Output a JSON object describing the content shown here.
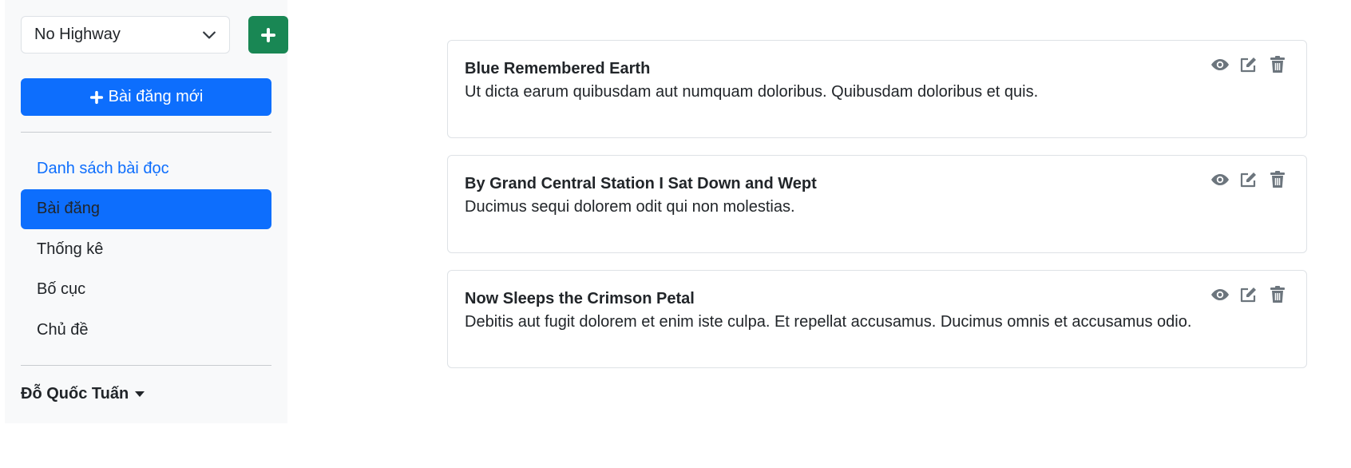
{
  "sidebar": {
    "blog_select": {
      "value": "No Highway"
    },
    "new_post_label": "Bài đăng mới",
    "nav": [
      {
        "label": "Danh sách bài đọc",
        "state": "link"
      },
      {
        "label": "Bài đăng",
        "state": "active"
      },
      {
        "label": "Thống kê",
        "state": "normal"
      },
      {
        "label": "Bố cục",
        "state": "normal"
      },
      {
        "label": "Chủ đề",
        "state": "normal"
      }
    ],
    "user": {
      "name": "Đỗ Quốc Tuấn"
    }
  },
  "posts": [
    {
      "title": "Blue Remembered Earth",
      "excerpt": "Ut dicta earum quibusdam aut numquam doloribus. Quibusdam doloribus et quis."
    },
    {
      "title": "By Grand Central Station I Sat Down and Wept",
      "excerpt": "Ducimus sequi dolorem odit qui non molestias."
    },
    {
      "title": "Now Sleeps the Crimson Petal",
      "excerpt": "Debitis aut fugit dolorem et enim iste culpa. Et repellat accusamus. Ducimus omnis et accusamus odio."
    }
  ],
  "icons": {
    "view": "eye-icon",
    "edit": "edit-icon",
    "delete": "trash-icon",
    "add": "plus-icon",
    "dropdown": "chevron-down-icon"
  },
  "colors": {
    "primary": "#0d6efd",
    "success": "#198754",
    "sidebar_bg": "#f8f9fa",
    "icon_gray": "#6c757d"
  }
}
